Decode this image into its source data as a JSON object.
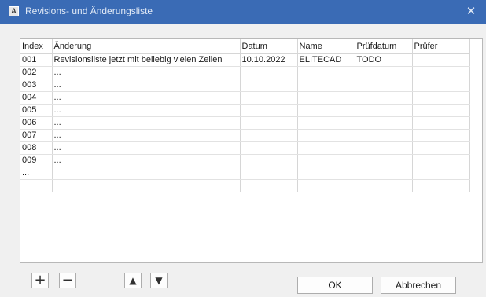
{
  "window": {
    "title": "Revisions- und Änderungsliste",
    "app_icon": "A",
    "close_glyph": "✕"
  },
  "table": {
    "columns": [
      "Index",
      "Änderung",
      "Datum",
      "Name",
      "Prüfdatum",
      "Prüfer"
    ],
    "rows": [
      [
        "001",
        "Revisionsliste jetzt mit beliebig vielen Zeilen",
        "10.10.2022",
        "ELITECAD",
        "TODO",
        ""
      ],
      [
        "002",
        "...",
        "",
        "",
        "",
        ""
      ],
      [
        "003",
        "...",
        "",
        "",
        "",
        ""
      ],
      [
        "004",
        "...",
        "",
        "",
        "",
        ""
      ],
      [
        "005",
        "...",
        "",
        "",
        "",
        ""
      ],
      [
        "006",
        "...",
        "",
        "",
        "",
        ""
      ],
      [
        "007",
        "...",
        "",
        "",
        "",
        ""
      ],
      [
        "008",
        "...",
        "",
        "",
        "",
        ""
      ],
      [
        "009",
        "...",
        "",
        "",
        "",
        ""
      ],
      [
        "...",
        "",
        "",
        "",
        "",
        ""
      ],
      [
        "",
        "",
        "",
        "",
        "",
        ""
      ]
    ]
  },
  "toolbar": {
    "add_glyph": "+",
    "remove_glyph": "−",
    "up_glyph": "▲",
    "down_glyph": "▼",
    "ok_label": "OK",
    "cancel_label": "Abbrechen"
  },
  "icons": {
    "add": "plus-icon",
    "remove": "minus-icon",
    "up": "arrow-up-icon",
    "down": "arrow-down-icon",
    "close": "close-icon"
  },
  "colors": {
    "titlebar": "#3a6bb5",
    "window_bg": "#f0f0f0",
    "grid_bg": "#ffffff"
  }
}
